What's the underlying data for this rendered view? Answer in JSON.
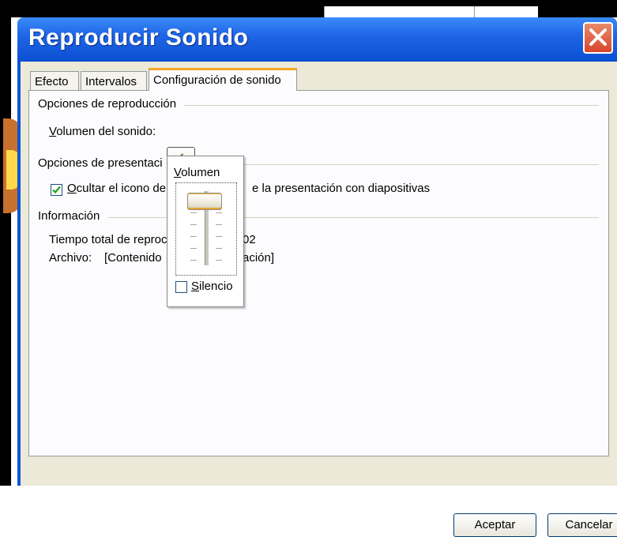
{
  "window": {
    "title": "Reproducir Sonido"
  },
  "tabs": [
    {
      "label": "Efecto"
    },
    {
      "label": "Intervalos"
    },
    {
      "label": "Configuración de sonido"
    }
  ],
  "playback_options": {
    "group_label": "Opciones de reproducción",
    "volume_label_underlined": "V",
    "volume_label_rest": "olumen del sonido:"
  },
  "presentation_options": {
    "group_label": "Opciones de presentaci",
    "hide_icon_checkbox": {
      "checked": true,
      "label_underlined": "O",
      "label_part1": "cultar el icono de",
      "label_part2": "e la presentación con diapositivas"
    }
  },
  "information": {
    "group_label": "Información",
    "total_time_label": "Tiempo total de reproc",
    "total_time_value": "02",
    "file_label": "Archivo:",
    "file_value_part1": "[Contenido",
    "file_value_part2": "ación]"
  },
  "volume_popup": {
    "title_underlined": "V",
    "title_rest": "olumen",
    "level_fraction": 1.0,
    "mute_checked": false,
    "mute_label_underlined": "S",
    "mute_label_rest": "ilencio"
  },
  "buttons": {
    "ok": "Aceptar",
    "cancel": "Cancelar"
  },
  "colors": {
    "titlebar": "#0b4fd2",
    "tab_highlight": "#f5a623",
    "dialog_face": "#ece9d8"
  }
}
